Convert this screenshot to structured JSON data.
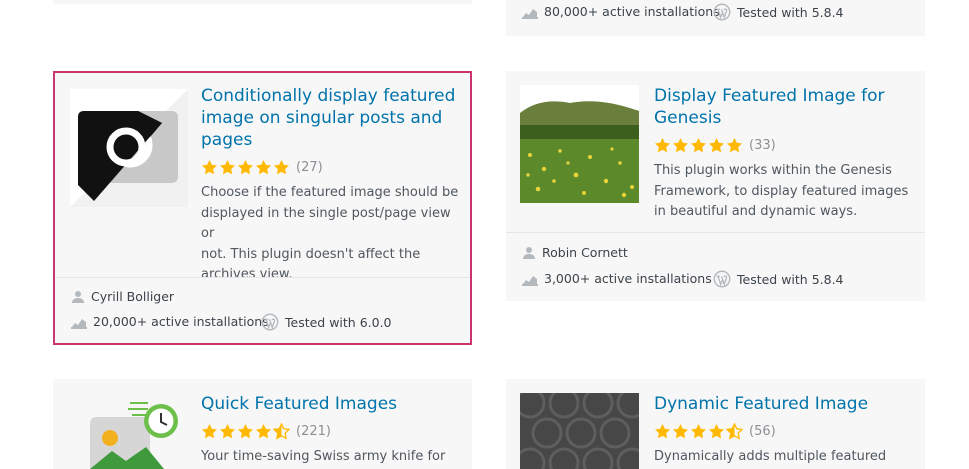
{
  "top_partial": {
    "installs": "80,000+ active installations",
    "tested": "Tested with 5.8.4"
  },
  "plugins": [
    {
      "title_lines": [
        "Conditionally display featured",
        "image on singular posts and",
        "pages"
      ],
      "stars": 5,
      "rating_count": "(27)",
      "desc_lines": [
        "Choose if the featured image should be",
        "displayed in the single post/page view or",
        "not. This plugin doesn't affect the",
        "archives view."
      ],
      "author": "Cyrill Bolliger",
      "installs": "20,000+ active installations",
      "tested": "Tested with 6.0.0"
    },
    {
      "title_lines": [
        "Display Featured Image for",
        "Genesis"
      ],
      "stars": 5,
      "rating_count": "(33)",
      "desc_lines": [
        "This plugin works within the Genesis",
        "Framework, to display featured images",
        "in beautiful and dynamic ways."
      ],
      "author": "Robin Cornett",
      "installs": "3,000+ active installations",
      "tested": "Tested with 5.8.4"
    },
    {
      "title_lines": [
        "Quick Featured Images"
      ],
      "stars": 4.5,
      "rating_count": "(221)",
      "desc_lines": [
        "Your time-saving Swiss army knife for"
      ]
    },
    {
      "title_lines": [
        "Dynamic Featured Image"
      ],
      "stars": 4.5,
      "rating_count": "(56)",
      "desc_lines": [
        "Dynamically adds multiple featured"
      ]
    }
  ],
  "colors": {
    "link": "#0073aa",
    "star": "#ffb900",
    "selected_border": "#c9356e",
    "card_bg": "#f7f7f7"
  },
  "icons": [
    "user-icon",
    "chart-icon",
    "wordpress-icon",
    "star-icon"
  ]
}
